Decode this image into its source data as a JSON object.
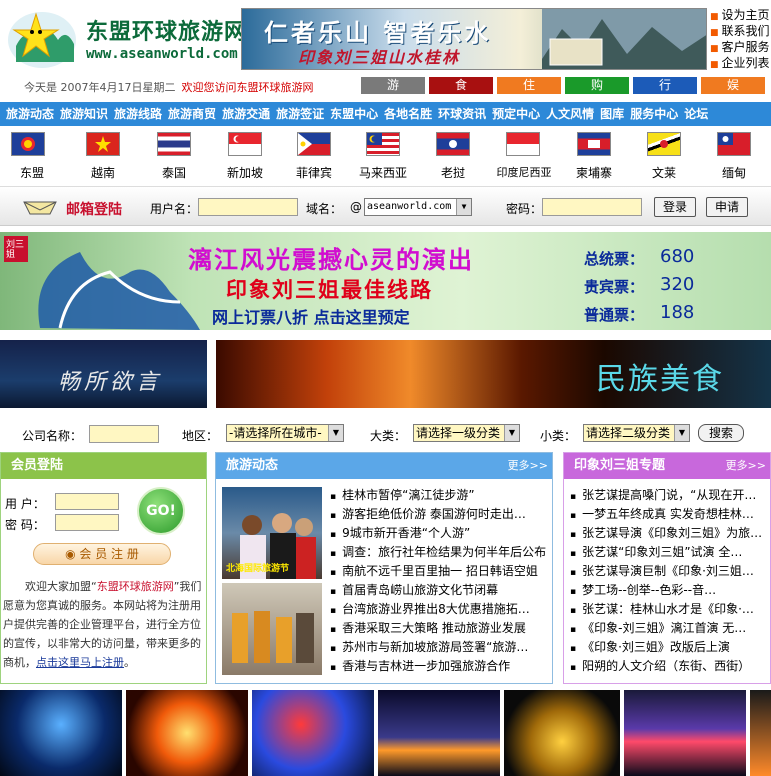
{
  "header": {
    "site_title": "东盟环球旅游网",
    "site_url": "www.aseanworld.com",
    "banner_line1": "仁者乐山 智者乐水",
    "banner_line2": "印象刘三姐山水桂林",
    "top_links": [
      "设为主页",
      "联系我们",
      "客户服务",
      "企业列表"
    ]
  },
  "datebar": {
    "date_text": "今天是 2007年4月17日星期二",
    "welcome": "欢迎您访问东盟环球旅游网"
  },
  "categories": [
    {
      "label": "游",
      "color": "#7a7a7a"
    },
    {
      "label": "食",
      "color": "#a81010"
    },
    {
      "label": "住",
      "color": "#f07a20"
    },
    {
      "label": "购",
      "color": "#1a9a2a"
    },
    {
      "label": "行",
      "color": "#1c5bb8"
    },
    {
      "label": "娱",
      "color": "#f07a20"
    }
  ],
  "nav": [
    "旅游动态",
    "旅游知识",
    "旅游线路",
    "旅游商贸",
    "旅游交通",
    "旅游签证",
    "东盟中心",
    "各地名胜",
    "环球资讯",
    "预定中心",
    "人文风情",
    "图库",
    "服务中心",
    "论坛"
  ],
  "flags": [
    {
      "name": "东盟",
      "icon": "asean-flag-icon"
    },
    {
      "name": "越南",
      "icon": "vietnam-flag-icon"
    },
    {
      "name": "泰国",
      "icon": "thailand-flag-icon"
    },
    {
      "name": "新加坡",
      "icon": "singapore-flag-icon"
    },
    {
      "name": "菲律宾",
      "icon": "philippines-flag-icon"
    },
    {
      "name": "马来西亚",
      "icon": "malaysia-flag-icon"
    },
    {
      "name": "老挝",
      "icon": "laos-flag-icon"
    },
    {
      "name": "印度尼西亚",
      "icon": "indonesia-flag-icon"
    },
    {
      "name": "柬埔寨",
      "icon": "cambodia-flag-icon"
    },
    {
      "name": "文莱",
      "icon": "brunei-flag-icon"
    },
    {
      "name": "缅甸",
      "icon": "myanmar-flag-icon"
    }
  ],
  "mail": {
    "title": "邮箱登陆",
    "user_label": "用户名：",
    "domain_label": "域名：",
    "at": "@",
    "domain_value": "aseanworld.com",
    "pass_label": "密码：",
    "login_btn": "登录",
    "register_btn": "申请"
  },
  "big_banner": {
    "line1": "漓江风光震撼心灵的演出",
    "line2": "印象刘三姐最佳线路",
    "line3": "网上订票八折   点击这里预定",
    "seal": "刘三姐",
    "prices": [
      {
        "label": "总统票：",
        "value": "680"
      },
      {
        "label": "贵宾票：",
        "value": "320"
      },
      {
        "label": "普通票：",
        "value": "188"
      }
    ]
  },
  "mid_banners": {
    "left": "畅所欲言",
    "right": "民族美食"
  },
  "search": {
    "company_label": "公司名称：",
    "region_label": "地区：",
    "region_value": "-请选择所在城市-",
    "big_label": "大类：",
    "big_value": "请选择一级分类",
    "small_label": "小类：",
    "small_value": "请选择二级分类",
    "search_btn": "搜索"
  },
  "member": {
    "title": "会员登陆",
    "user_label": "用  户：",
    "pass_label": "密  码：",
    "go": "GO!",
    "register": "会 员 注 册",
    "intro1": "欢迎大家加盟“",
    "intro_site": "东盟环球旅游网",
    "intro2": "”",
    "intro3": "我们愿意为您真诚的服务。本网站将为注册用户提供完善的企业管理平台，进行全方位的宣传，以非常大的访问量，带来更多的商机，",
    "intro_link": "点击这里马上注册",
    "intro_end": "。"
  },
  "travel_news": {
    "title": "旅游动态",
    "more": "更多>>",
    "items": [
      "桂林市暂停“漓江徒步游”",
      "游客拒绝低价游 泰国游何时走出…",
      "9城市新开香港“个人游”",
      "调查：旅行社年检结果为何半年后公布",
      "南航不远千里百里抽一 招日韩语空姐",
      "首届青岛崂山旅游文化节闭幕",
      "台湾旅游业界推出8大优惠措施拓…",
      "香港采取三大策略  推动旅游业发展",
      "苏州市与新加坡旅游局签署“旅游…",
      "香港与吉林进一步加强旅游合作"
    ]
  },
  "liusanjie": {
    "title": "印象刘三姐专题",
    "more": "更多>>",
    "items": [
      "张艺谋提高嗓门说，“从现在开…",
      "一梦五年终成真 实发奇想桂林…",
      "张艺谋导演《印象刘三姐》为旅…",
      "张艺谋“印象刘三姐”试演 全…",
      "张艺谋导演巨制《印象·刘三姐…",
      "梦工场--创举--色彩--音…",
      "张艺谋：桂林山水才是《印象·…",
      "《印象-刘三姐》漓江首演 无…",
      "《印象·刘三姐》改版后上演",
      "阳朔的人文介绍（东街、西街）"
    ]
  },
  "news_photo_caption": "北海国际旅游节"
}
